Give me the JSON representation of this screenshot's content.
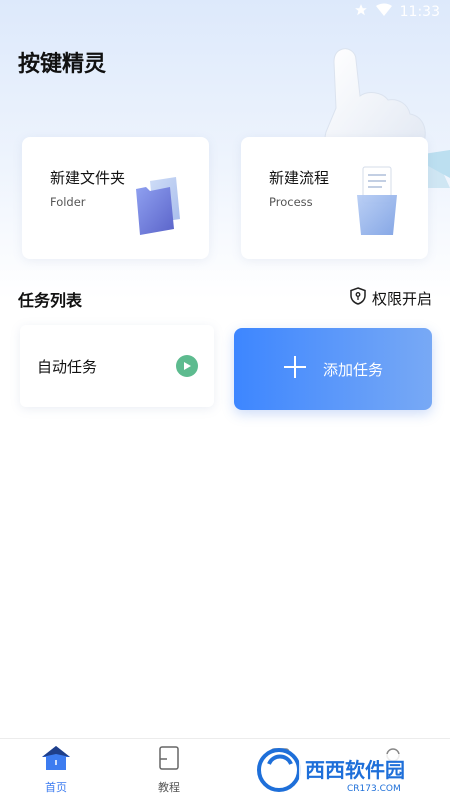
{
  "status_bar": {
    "time": "11:33",
    "icons": [
      "star-icon",
      "wifi-icon"
    ]
  },
  "app": {
    "title": "按键精灵"
  },
  "cards": {
    "folder": {
      "title": "新建文件夹",
      "subtitle": "Folder",
      "icon": "folder-icon"
    },
    "process": {
      "title": "新建流程",
      "subtitle": "Process",
      "icon": "document-icon"
    }
  },
  "task_section": {
    "title": "任务列表",
    "permission_label": "权限开启",
    "permission_icon": "shield-key-icon"
  },
  "tasks": [
    {
      "label": "自动任务",
      "action_icon": "play-icon"
    }
  ],
  "add_task": {
    "label": "添加任务",
    "icon": "plus-icon"
  },
  "bottom_nav": {
    "items": [
      {
        "label": "首页",
        "icon": "home-icon",
        "active": true
      },
      {
        "label": "教程",
        "icon": "tutorial-icon",
        "active": false
      },
      {
        "label": "",
        "icon": "market-icon",
        "active": false
      },
      {
        "label": "",
        "icon": "profile-icon",
        "active": false
      }
    ]
  },
  "watermark": {
    "text_main": "西西软件园",
    "text_sub": "CR173.COM"
  },
  "colors": {
    "accent": "#3d7cf0",
    "play": "#5dbb8f",
    "add_gradient_start": "#3d86ff",
    "add_gradient_end": "#78a9f5"
  }
}
